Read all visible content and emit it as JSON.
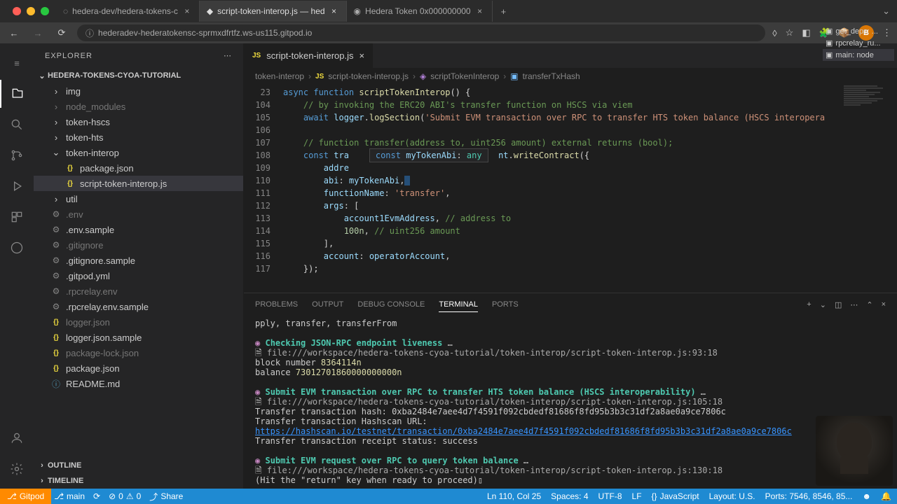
{
  "browser": {
    "tabs": [
      {
        "title": "hedera-dev/hedera-tokens-c"
      },
      {
        "title": "script-token-interop.js — hed"
      },
      {
        "title": "Hedera Token 0x000000000"
      }
    ],
    "url": "hederadev-hederatokensc-sprmxdfrtfz.ws-us115.gitpod.io",
    "avatar": "B"
  },
  "explorer": {
    "title": "EXPLORER",
    "project": "HEDERA-TOKENS-CYOA-TUTORIAL",
    "tree": [
      {
        "name": "img",
        "type": "folder",
        "indent": 0
      },
      {
        "name": "node_modules",
        "type": "folder",
        "indent": 0,
        "dim": true
      },
      {
        "name": "token-hscs",
        "type": "folder",
        "indent": 0
      },
      {
        "name": "token-hts",
        "type": "folder",
        "indent": 0
      },
      {
        "name": "token-interop",
        "type": "folder",
        "indent": 0,
        "open": true
      },
      {
        "name": "package.json",
        "type": "js",
        "indent": 1
      },
      {
        "name": "script-token-interop.js",
        "type": "js",
        "indent": 1,
        "selected": true
      },
      {
        "name": "util",
        "type": "folder",
        "indent": 0
      },
      {
        "name": ".env",
        "type": "gear",
        "indent": 0,
        "dim": true
      },
      {
        "name": ".env.sample",
        "type": "gear",
        "indent": 0
      },
      {
        "name": ".gitignore",
        "type": "gear",
        "indent": 0,
        "dim": true
      },
      {
        "name": ".gitignore.sample",
        "type": "gear",
        "indent": 0
      },
      {
        "name": ".gitpod.yml",
        "type": "gear",
        "indent": 0
      },
      {
        "name": ".rpcrelay.env",
        "type": "gear",
        "indent": 0,
        "dim": true
      },
      {
        "name": ".rpcrelay.env.sample",
        "type": "gear",
        "indent": 0
      },
      {
        "name": "logger.json",
        "type": "js",
        "indent": 0,
        "dim": true
      },
      {
        "name": "logger.json.sample",
        "type": "js",
        "indent": 0
      },
      {
        "name": "package-lock.json",
        "type": "js",
        "indent": 0,
        "dim": true
      },
      {
        "name": "package.json",
        "type": "js",
        "indent": 0
      },
      {
        "name": "README.md",
        "type": "info",
        "indent": 0
      }
    ],
    "outline": "OUTLINE",
    "timeline": "TIMELINE"
  },
  "editor": {
    "tab_label": "script-token-interop.js",
    "breadcrumbs": [
      "token-interop",
      "script-token-interop.js",
      "scriptTokenInterop",
      "transferTxHash"
    ],
    "hint": {
      "keyword": "const",
      "name": "myTokenAbi",
      "type": "any"
    },
    "lines": [
      {
        "num": "23"
      },
      {
        "num": "104"
      },
      {
        "num": "105"
      },
      {
        "num": "106"
      },
      {
        "num": "107"
      },
      {
        "num": "108"
      },
      {
        "num": "109"
      },
      {
        "num": "110"
      },
      {
        "num": "111"
      },
      {
        "num": "112"
      },
      {
        "num": "113"
      },
      {
        "num": "114"
      },
      {
        "num": "115"
      },
      {
        "num": "116"
      },
      {
        "num": "117"
      }
    ]
  },
  "panel": {
    "tabs": [
      "PROBLEMS",
      "OUTPUT",
      "DEBUG CONSOLE",
      "TERMINAL",
      "PORTS"
    ],
    "active_tab": "TERMINAL",
    "side_tasks": [
      "get_deps: ...",
      "rpcrelay_ru...",
      "main: node"
    ],
    "terminal": {
      "line1": "pply, transfer, transferFrom",
      "sec1": "Checking JSON-RPC endpoint liveness",
      "file1": "file:///workspace/hedera-tokens-cyoa-tutorial/token-interop/script-token-interop.js:93:18",
      "blocknum_label": "block number ",
      "blocknum": "8364114n",
      "balance_label": "balance ",
      "balance": "73012701860000000000n",
      "sec2": "Submit EVM transaction over RPC to transfer HTS token balance (HSCS interoperability)",
      "file2": "file:///workspace/hedera-tokens-cyoa-tutorial/token-interop/script-token-interop.js:105:18",
      "txhash_label": "Transfer transaction hash: ",
      "txhash": "0xba2484e7aee4d7f4591f092cbdedf81686f8fd95b3b3c31df2a8ae0a9ce7806c",
      "hashscan_label": "Transfer transaction Hashscan URL:",
      "hashscan_url": "https://hashscan.io/testnet/transaction/0xba2484e7aee4d7f4591f092cbdedf81686f8fd95b3b3c31df2a8ae0a9ce7806c",
      "receipt": "Transfer transaction receipt status: success",
      "sec3": "Submit EVM request over RPC to query token balance",
      "file3": "file:///workspace/hedera-tokens-cyoa-tutorial/token-interop/script-token-interop.js:130:18",
      "hitreturn": "(Hit the \"return\" key when ready to proceed)▯"
    }
  },
  "status": {
    "gitpod": "Gitpod",
    "branch": "main",
    "sync": "",
    "errors": "0",
    "warnings": "0",
    "share": "Share",
    "lncol": "Ln 110, Col 25",
    "spaces": "Spaces: 4",
    "encoding": "UTF-8",
    "eol": "LF",
    "lang": "JavaScript",
    "layout": "Layout: U.S.",
    "ports": "Ports: 7546, 8546, 85..."
  }
}
